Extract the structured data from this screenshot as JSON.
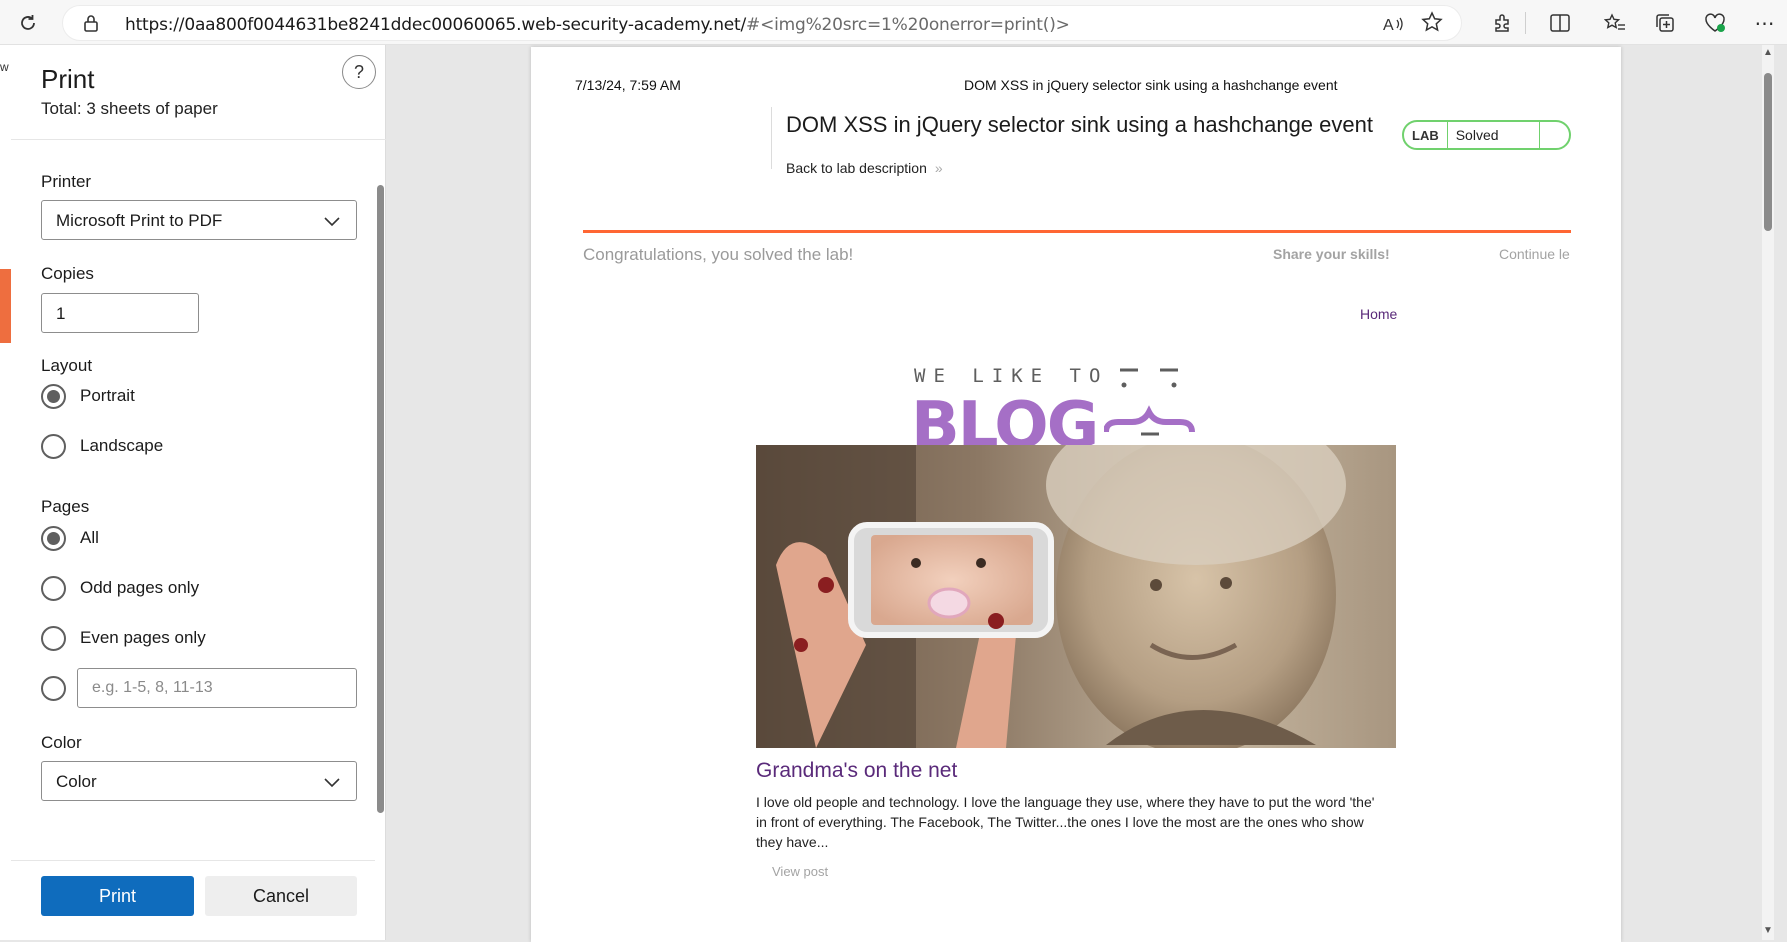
{
  "browser": {
    "url_host": "https://0aa800f0044631be8241ddec00060065.web-security-academy.net/",
    "url_path": "#<img%20src=1%20onerror=print()>",
    "left_edge_text": "w",
    "icons": [
      "refresh-icon",
      "lock-icon",
      "read-aloud-icon",
      "favorite-star-icon",
      "extensions-icon",
      "split-screen-icon",
      "favorites-icon",
      "collections-icon",
      "browser-essentials-icon",
      "more-icon"
    ]
  },
  "print_panel": {
    "title": "Print",
    "total": "Total: 3 sheets of paper",
    "help": "?",
    "printer": {
      "label": "Printer",
      "value": "Microsoft Print to PDF"
    },
    "copies": {
      "label": "Copies",
      "value": "1"
    },
    "layout": {
      "label": "Layout",
      "options": [
        {
          "label": "Portrait",
          "selected": true
        },
        {
          "label": "Landscape",
          "selected": false
        }
      ]
    },
    "pages": {
      "label": "Pages",
      "options": [
        {
          "label": "All",
          "selected": true
        },
        {
          "label": "Odd pages only",
          "selected": false
        },
        {
          "label": "Even pages only",
          "selected": false
        }
      ],
      "custom_placeholder": "e.g. 1-5, 8, 11-13"
    },
    "color": {
      "label": "Color",
      "value": "Color"
    },
    "print_button": "Print",
    "cancel_button": "Cancel"
  },
  "preview": {
    "header_date": "7/13/24, 7:59 AM",
    "header_title": "DOM XSS in jQuery selector sink using a hashchange event",
    "lab_title": "DOM XSS in jQuery selector sink using a hashchange event",
    "back_link": "Back to lab description",
    "badge_lab": "LAB",
    "badge_status": "Solved",
    "congrats": "Congratulations, you solved the lab!",
    "share": "Share your skills!",
    "continue": "Continue le",
    "home": "Home",
    "logo_top": "WE LIKE TO",
    "logo_main": "BLOG",
    "post_title": "Grandma's on the net",
    "post_body": "I love old people and technology. I love the language they use, where they have to put the word 'the' in front of everything. The Facebook, The Twitter...the ones I love the most are the ones who show they have...",
    "view_post": "View post"
  },
  "colors": {
    "accent": "#0f6cbd",
    "lab_orange": "#ff6633",
    "solved_green": "#70d16d",
    "blog_purple": "#a56fc6",
    "link_purple": "#5a2a7a"
  }
}
